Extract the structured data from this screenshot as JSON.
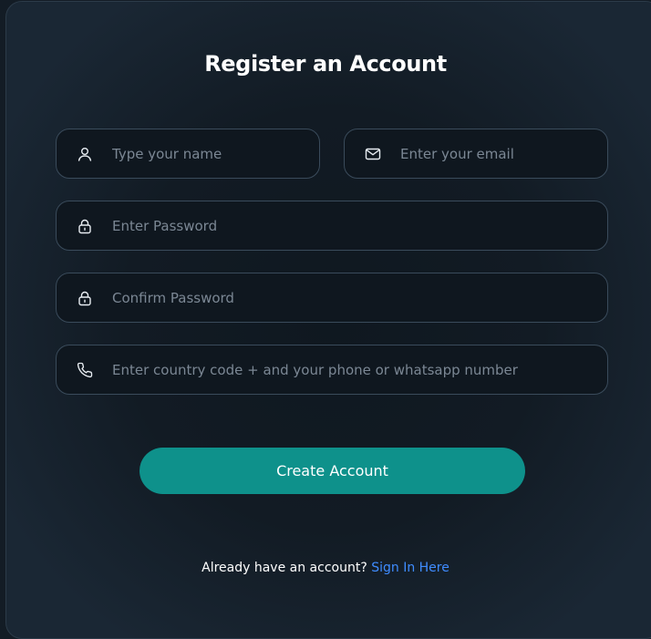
{
  "form": {
    "title": "Register an Account",
    "fields": {
      "name": {
        "icon": "user-icon",
        "placeholder": "Type your name",
        "value": ""
      },
      "email": {
        "icon": "envelope-icon",
        "placeholder": "Enter your email",
        "value": ""
      },
      "password": {
        "icon": "lock-icon",
        "placeholder": "Enter Password",
        "value": ""
      },
      "confirm_password": {
        "icon": "lock-icon",
        "placeholder": "Confirm Password",
        "value": ""
      },
      "phone": {
        "icon": "phone-icon",
        "placeholder": "Enter country code + and your phone or whatsapp number",
        "value": ""
      }
    },
    "submit_label": "Create Account",
    "signin_prompt": "Already have an account?",
    "signin_link": "Sign In Here"
  },
  "colors": {
    "background": "#131c25",
    "field_background": "#0f171f",
    "field_border": "#3a4b5b",
    "accent": "#0e918b",
    "link": "#3f8cff",
    "placeholder": "#7b8794"
  }
}
